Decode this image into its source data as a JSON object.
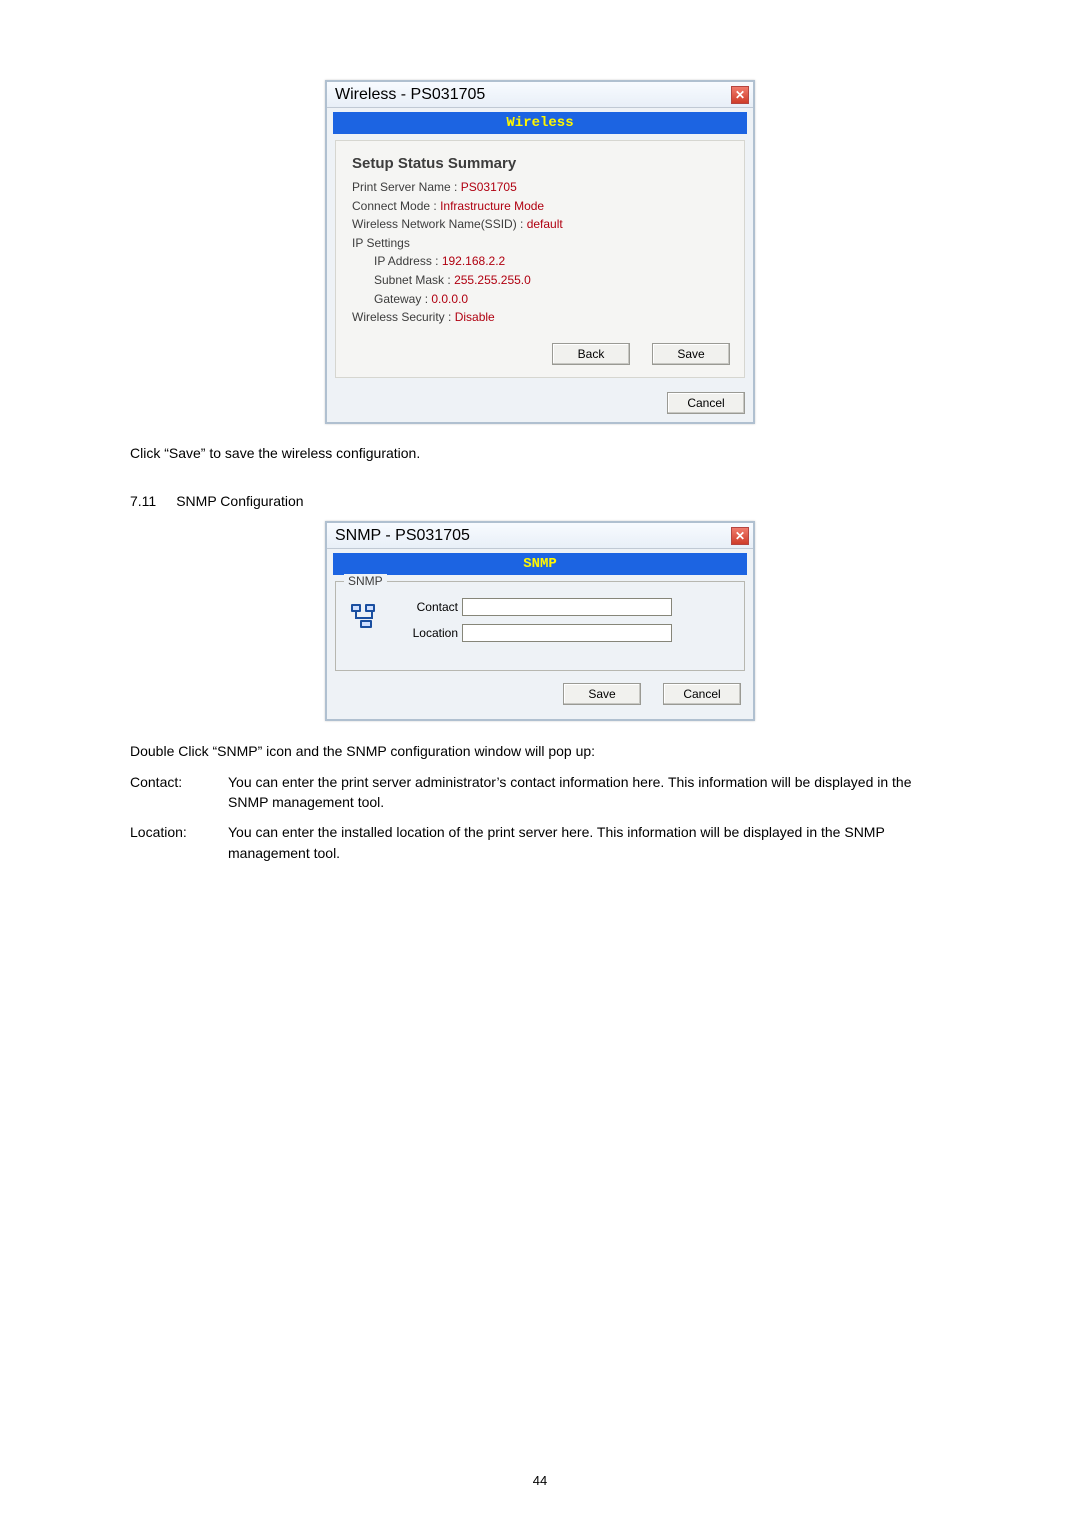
{
  "wireless": {
    "title": "Wireless - PS031705",
    "banner": "Wireless",
    "summary_heading": "Setup Status Summary",
    "name_label": "Print Server Name :",
    "name_value": "PS031705",
    "mode_label": "Connect Mode :",
    "mode_value": "Infrastructure Mode",
    "ssid_label": "Wireless Network Name(SSID) :",
    "ssid_value": "default",
    "ip_heading": "IP Settings",
    "ip_label": "IP Address :",
    "ip_value": "192.168.2.2",
    "mask_label": "Subnet Mask :",
    "mask_value": "255.255.255.0",
    "gw_label": "Gateway :",
    "gw_value": "0.0.0.0",
    "sec_label": "Wireless Security :",
    "sec_value": "Disable",
    "back": "Back",
    "save": "Save",
    "cancel": "Cancel"
  },
  "after_wireless": "Click “Save” to save the wireless configuration.",
  "section": {
    "num": "7.11",
    "title": "SNMP Configuration"
  },
  "snmp": {
    "title": "SNMP - PS031705",
    "banner": "SNMP",
    "legend": "SNMP",
    "contact_label": "Contact",
    "location_label": "Location",
    "contact_value": "",
    "location_value": "",
    "save": "Save",
    "cancel": "Cancel"
  },
  "intro": "Double Click “SNMP” icon and the SNMP configuration window will pop up:",
  "defs": {
    "contact_term": "Contact:",
    "contact_text": "You can enter the print server administrator’s contact information here. This information will be displayed in the SNMP management tool.",
    "location_term": "Location:",
    "location_text": "You can enter the installed location of the print server here. This information will be displayed in the SNMP management tool."
  },
  "page_number": "44"
}
